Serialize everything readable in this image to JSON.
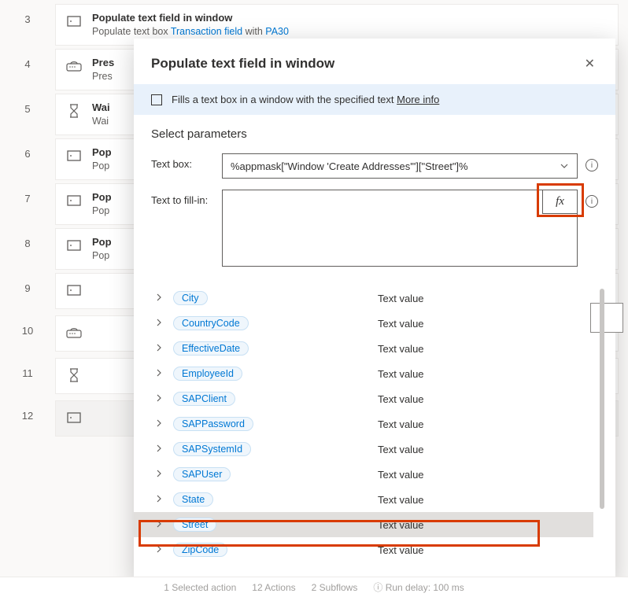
{
  "actions": [
    {
      "num": "3",
      "icon": "textbox",
      "title": "Populate text field in window",
      "sub_pre": "Populate text box ",
      "sub_link1": "Transaction field",
      "sub_mid": " with ",
      "sub_link2": "PA30"
    },
    {
      "num": "4",
      "icon": "keyboard",
      "title": "Pres",
      "sub_pre": "Pres"
    },
    {
      "num": "5",
      "icon": "hourglass",
      "title": "Wai",
      "sub_pre": "Wai"
    },
    {
      "num": "6",
      "icon": "textbox",
      "title": "Pop",
      "sub_pre": "Pop"
    },
    {
      "num": "7",
      "icon": "textbox",
      "title": "Pop",
      "sub_pre": "Pop"
    },
    {
      "num": "8",
      "icon": "textbox",
      "title": "Pop",
      "sub_pre": "Pop"
    },
    {
      "num": "9",
      "icon": "textbox",
      "title": ""
    },
    {
      "num": "10",
      "icon": "keyboard",
      "title": ""
    },
    {
      "num": "11",
      "icon": "hourglass",
      "title": ""
    },
    {
      "num": "12",
      "icon": "textbox",
      "title": "",
      "selected": true
    }
  ],
  "dialog": {
    "title": "Populate text field in window",
    "info_text": "Fills a text box in a window with the specified text ",
    "info_link": "More info",
    "params_heading": "Select parameters",
    "textbox_label": "Text box:",
    "textbox_value": "%appmask[\"Window 'Create Addresses'\"][\"Street\"]%",
    "fillin_label": "Text to fill-in:",
    "fillin_value": "",
    "fx_label": "fx"
  },
  "variables": [
    {
      "name": "City",
      "type": "Text value"
    },
    {
      "name": "CountryCode",
      "type": "Text value"
    },
    {
      "name": "EffectiveDate",
      "type": "Text value"
    },
    {
      "name": "EmployeeId",
      "type": "Text value"
    },
    {
      "name": "SAPClient",
      "type": "Text value"
    },
    {
      "name": "SAPPassword",
      "type": "Text value"
    },
    {
      "name": "SAPSystemId",
      "type": "Text value"
    },
    {
      "name": "SAPUser",
      "type": "Text value"
    },
    {
      "name": "State",
      "type": "Text value"
    },
    {
      "name": "Street",
      "type": "Text value",
      "selected": true
    },
    {
      "name": "ZipCode",
      "type": "Text value"
    }
  ],
  "status": {
    "selected": "1 Selected action",
    "actions": "12 Actions",
    "subflows": "2 Subflows",
    "delay_label": "Run delay:",
    "delay_val": "100",
    "delay_unit": "ms"
  }
}
